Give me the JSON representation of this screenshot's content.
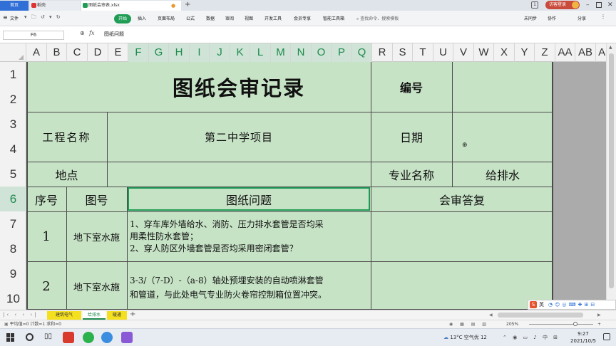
{
  "tabs": {
    "home": "首页",
    "daoke": "稻壳",
    "file": "图纸会审表.xlsx"
  },
  "topbar": {
    "login": "访客登录"
  },
  "menu": {
    "file": "文件",
    "start": "开始",
    "insert": "插入",
    "layout": "页面布局",
    "formula": "公式",
    "data": "数据",
    "review": "审阅",
    "view": "视图",
    "devtools": "开发工具",
    "member": "会员专享",
    "smart": "智能工具箱",
    "search_placeholder": "查找命令、搜索模板",
    "sync": "未同步",
    "collab": "协作",
    "share": "分享"
  },
  "formula_bar": {
    "cell_ref": "F6",
    "fx": "fx",
    "value": "图纸问题"
  },
  "columns": [
    "A",
    "B",
    "C",
    "D",
    "E",
    "F",
    "G",
    "H",
    "I",
    "J",
    "K",
    "L",
    "M",
    "N",
    "O",
    "P",
    "Q",
    "R",
    "S",
    "T",
    "U",
    "V",
    "W",
    "X",
    "Y",
    "Z",
    "AA",
    "AB",
    "AC"
  ],
  "rows": [
    "1",
    "2",
    "3",
    "4",
    "5",
    "6",
    "7",
    "8",
    "9",
    "10"
  ],
  "sheet": {
    "title": "图纸会审记录",
    "number_label": "编号",
    "project_label": "工程名称",
    "project_name": "第二中学项目",
    "date_label": "日期",
    "place_label": "地点",
    "discipline_label": "专业名称",
    "discipline_value": "给排水",
    "headers": {
      "seq": "序号",
      "drawing": "图号",
      "problem": "图纸问题",
      "reply": "会审答复"
    },
    "records": [
      {
        "seq": "1",
        "drawing": "地下室水施",
        "problem_lines": [
          "1、穿车库外墙给水、消防、压力排水套管是否均采",
          "用柔性防水套管；",
          "2、穿人防区外墙套管是否均采用密闭套管？"
        ]
      },
      {
        "seq": "2",
        "drawing": "地下室水施",
        "problem_lines": [
          "3-3/（7-D）-（a-8）轴处预埋安装的自动喷淋套管",
          "和管道，与此处电气专业防火卷帘控制箱位置冲突。"
        ]
      }
    ]
  },
  "sheet_tabs": [
    "建筑电气",
    "给排水",
    "暖通"
  ],
  "status": {
    "summary": "平均值=0  计数=1  求和=0",
    "zoom": "205%"
  },
  "taskbar": {
    "weather": "13°C 空气优 12",
    "time": "9:27",
    "date": "2021/10/5"
  },
  "ime": {
    "label": "英"
  },
  "colors": {
    "cell_green": "#c7e3c6",
    "accent": "#1e8a4f",
    "selected_border": "#1e9a55",
    "start_button": "#1f9d55"
  }
}
